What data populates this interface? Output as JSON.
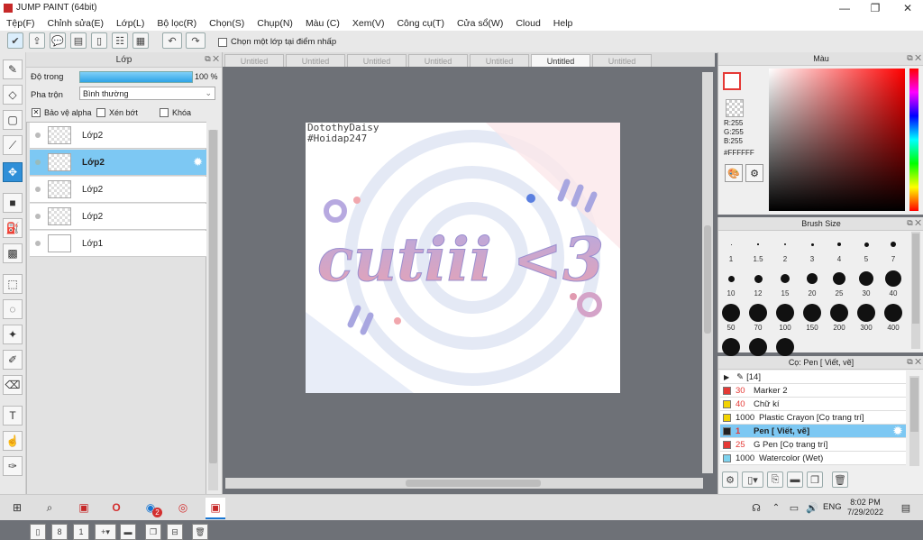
{
  "window": {
    "title": "JUMP PAINT (64bit)"
  },
  "menu": [
    "Tệp(F)",
    "Chỉnh sửa(E)",
    "Lớp(L)",
    "Bộ lọc(R)",
    "Chọn(S)",
    "Chụp(N)",
    "Màu (C)",
    "Xem(V)",
    "Công cụ(T)",
    "Cửa sổ(W)",
    "Cloud",
    "Help"
  ],
  "toolbar": {
    "pick_layer_label": "Chọn một lớp tại điểm nhấp"
  },
  "layer_panel": {
    "title": "Lớp",
    "opacity_label": "Độ trong",
    "opacity_value": "100 %",
    "opacity_fraction": 1.0,
    "blend_label": "Pha trộn",
    "blend_value": "Bình thường",
    "protect_alpha": "Bảo vệ alpha",
    "clipping": "Xén bớt",
    "lock": "Khóa",
    "layers": [
      {
        "name": "Lớp2",
        "selected": false
      },
      {
        "name": "Lớp2",
        "selected": true
      },
      {
        "name": "Lớp2",
        "selected": false
      },
      {
        "name": "Lớp2",
        "selected": false
      },
      {
        "name": "Lớp1",
        "selected": false
      }
    ]
  },
  "tabs": [
    {
      "label": "Untitled",
      "active": false
    },
    {
      "label": "Untitled",
      "active": false
    },
    {
      "label": "Untitled",
      "active": false
    },
    {
      "label": "Untitled",
      "active": false
    },
    {
      "label": "Untitled",
      "active": false
    },
    {
      "label": "Untitled",
      "active": true
    },
    {
      "label": "Untitled",
      "active": false
    }
  ],
  "canvas": {
    "credit_line1": "DotothyDaisy",
    "credit_line2": "#Hoidap247",
    "artwork_text": "cutiii <3"
  },
  "color_panel": {
    "title": "Màu",
    "r": "R:255",
    "g": "G:255",
    "b": "B:255",
    "hex": "#FFFFFF"
  },
  "brush_size_panel": {
    "title": "Brush Size",
    "sizes": [
      "1",
      "1.5",
      "2",
      "3",
      "4",
      "5",
      "7",
      "10",
      "12",
      "15",
      "20",
      "25",
      "30",
      "40",
      "50",
      "70",
      "100",
      "150",
      "200",
      "300",
      "400",
      "",
      "",
      ""
    ]
  },
  "brush_panel": {
    "title": "Cọ: Pen [ Viết, vẽ]",
    "group": "[14]",
    "items": [
      {
        "size": "30",
        "name": "Marker 2",
        "color": "#e53935"
      },
      {
        "size": "40",
        "name": "Chữ kí",
        "color": "#f2d300"
      },
      {
        "size": "1000",
        "name": "Plastic Crayon [Cọ trang trí]",
        "color": "#f2d300"
      },
      {
        "size": "1",
        "name": "Pen [ Viết, vẽ]",
        "color": "#222222",
        "selected": true
      },
      {
        "size": "25",
        "name": "G Pen [Cọ trang trí]",
        "color": "#e53935"
      },
      {
        "size": "1000",
        "name": "Watercolor (Wet)",
        "color": "#7fd3ef"
      }
    ]
  },
  "taskbar": {
    "lang": "ENG",
    "time": "8:02 PM",
    "date": "7/29/2022",
    "badge": "2"
  }
}
